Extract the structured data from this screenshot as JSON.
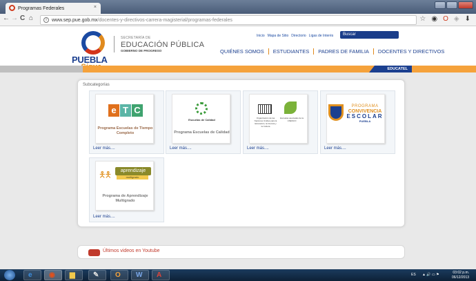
{
  "browser": {
    "tab_title": "Programas Federales",
    "tab_close": "×",
    "url_domain": "www.sep.pue.gob.mx",
    "url_path": "/docentes-y-directivos-carrera-magisterial/programas-federales",
    "back": "←",
    "forward": "→",
    "reload": "C",
    "home": "⌂",
    "star": "☆"
  },
  "header": {
    "logo_state": "PUEBLA",
    "logo_slogan": "Sigue",
    "secretaria_small": "SECRETARÍA DE",
    "secretaria_big": "EDUCACIÓN PÚBLICA",
    "gobierno": "GOBIERNO DE PROGRESO",
    "top_links": [
      "Inicio",
      "Mapa de Sitio",
      "Directorio",
      "Ligas de Interés"
    ],
    "search_label": "Buscar",
    "menu": [
      "QUIÉNES SOMOS",
      "ESTUDIANTES",
      "PADRES DE FAMILIA",
      "DOCENTES Y DIRECTIVOS"
    ],
    "educatel": "EDUCATEL"
  },
  "content": {
    "subcategorias_label": "Subcategorías",
    "cards": [
      {
        "caption": "Programa Escuelas de Tiempo Completo",
        "more": "Leer más...."
      },
      {
        "caption": "Programa Escuelas de Calidad",
        "logo_text": "Escuelas de Calidad",
        "more": "Leer más...."
      },
      {
        "caption": "",
        "logo_text_left": "Organización de las Naciones Unidas para la Educación, la Ciencia y la Cultura",
        "logo_text_right": "Escuelas asociadas de la UNESCO",
        "more": "Leer más...."
      },
      {
        "caption": "",
        "logo_a": "PROGRAMA",
        "logo_b": "CONVIVENCIA",
        "logo_c": "ESCOLAR",
        "logo_d": "PUEBLA",
        "more": "Leer más...."
      },
      {
        "caption": "Programa de Aprendizaje Multigrado",
        "logo_name": "aprendizaje",
        "logo_sub": "multigrado",
        "more": "Leer más...."
      }
    ],
    "etc_letters": [
      "e",
      "T",
      "C"
    ],
    "youtube_text": "Últimos videos en Youtube"
  },
  "taskbar": {
    "lang": "ES",
    "time": "03:02 p.m.",
    "date": "06/12/2013"
  },
  "colors": {
    "brand_blue": "#1b3f8f",
    "brand_orange": "#f5a23b",
    "youtube_red": "#c0392b"
  }
}
